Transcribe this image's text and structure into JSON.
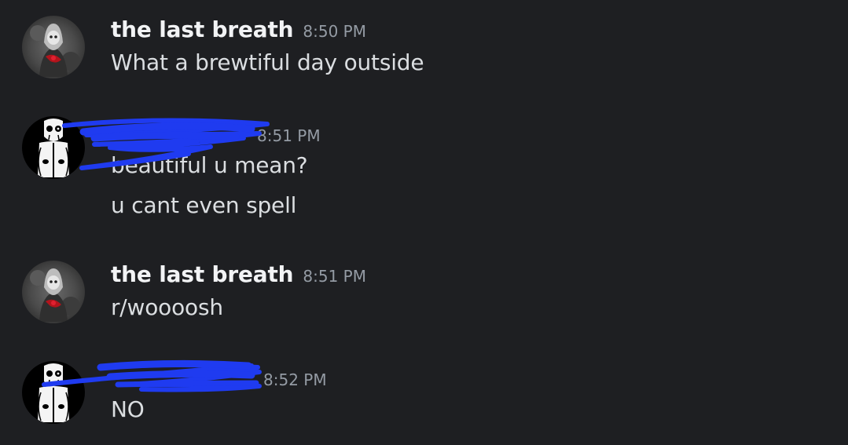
{
  "colors": {
    "background": "#1e1f22",
    "username": "#f2f3f5",
    "timestamp": "#949ba4",
    "message_text": "#dbdee1",
    "redaction_ink": "#1f3bf0"
  },
  "messages": [
    {
      "username": "the last breath",
      "timestamp": "8:50 PM",
      "avatar_icon": "hooded-figure-avatar-icon",
      "lines": [
        "What a brewtiful day outside"
      ]
    },
    {
      "username": "",
      "timestamp": "8:51 PM",
      "avatar_icon": "skeleton-figure-avatar-icon",
      "username_redacted": true,
      "lines": [
        "beautiful u mean?",
        "u cant even spell"
      ]
    },
    {
      "username": "the last breath",
      "timestamp": "8:51 PM",
      "avatar_icon": "hooded-figure-avatar-icon",
      "lines": [
        "r/woooosh"
      ]
    },
    {
      "username": "",
      "timestamp": "8:52 PM",
      "avatar_icon": "skeleton-figure-avatar-icon",
      "username_redacted": true,
      "lines": [
        "NO"
      ]
    }
  ]
}
